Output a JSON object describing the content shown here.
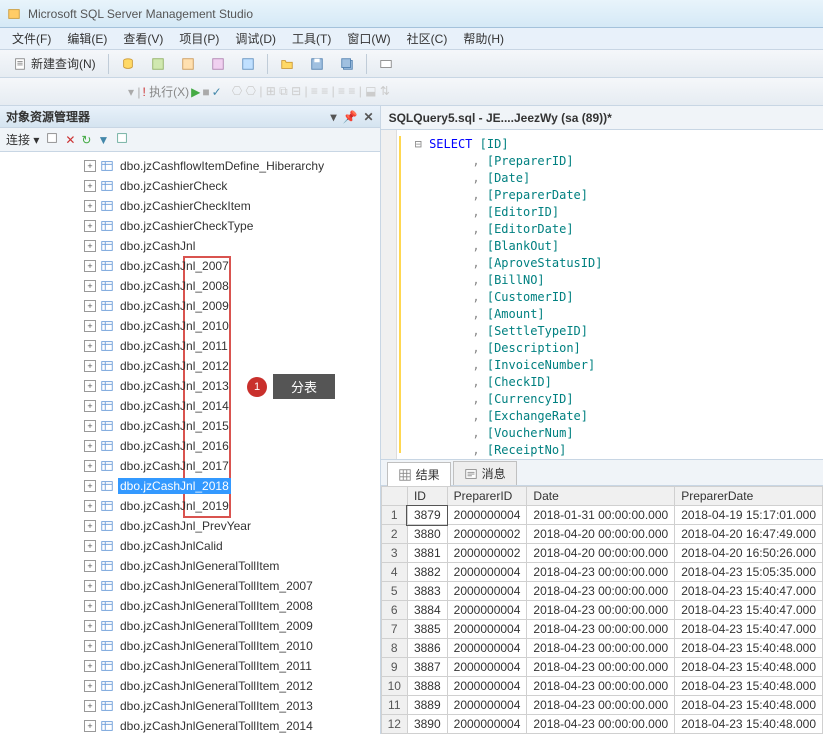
{
  "titlebar": {
    "title": "Microsoft SQL Server Management Studio"
  },
  "menubar": {
    "file": "文件(F)",
    "edit": "编辑(E)",
    "view": "查看(V)",
    "project": "项目(P)",
    "debug": "调试(D)",
    "tools": "工具(T)",
    "window": "窗口(W)",
    "community": "社区(C)",
    "help": "帮助(H)"
  },
  "toolbar": {
    "new_query": "新建查询(N)"
  },
  "toolbar2": {
    "execute": "执行(X)"
  },
  "left_pane": {
    "title": "对象资源管理器",
    "connect": "连接 ▾",
    "tree": [
      "dbo.jzCashflowItemDefine_Hiberarchy",
      "dbo.jzCashierCheck",
      "dbo.jzCashierCheckItem",
      "dbo.jzCashierCheckType",
      "dbo.jzCashJnl",
      "dbo.jzCashJnl_2007",
      "dbo.jzCashJnl_2008",
      "dbo.jzCashJnl_2009",
      "dbo.jzCashJnl_2010",
      "dbo.jzCashJnl_2011",
      "dbo.jzCashJnl_2012",
      "dbo.jzCashJnl_2013",
      "dbo.jzCashJnl_2014",
      "dbo.jzCashJnl_2015",
      "dbo.jzCashJnl_2016",
      "dbo.jzCashJnl_2017",
      "dbo.jzCashJnl_2018",
      "dbo.jzCashJnl_2019",
      "dbo.jzCashJnl_PrevYear",
      "dbo.jzCashJnlCalid",
      "dbo.jzCashJnlGeneralTollItem",
      "dbo.jzCashJnlGeneralTollItem_2007",
      "dbo.jzCashJnlGeneralTollItem_2008",
      "dbo.jzCashJnlGeneralTollItem_2009",
      "dbo.jzCashJnlGeneralTollItem_2010",
      "dbo.jzCashJnlGeneralTollItem_2011",
      "dbo.jzCashJnlGeneralTollItem_2012",
      "dbo.jzCashJnlGeneralTollItem_2013",
      "dbo.jzCashJnlGeneralTollItem_2014"
    ],
    "selected_index": 16,
    "annot": {
      "num": "1",
      "label": "分表"
    }
  },
  "right_pane": {
    "tab_title": "SQLQuery5.sql - JE....JeezWy (sa (89))*",
    "sql_select": "SELECT",
    "sql_first": "[ID]",
    "sql_cols": [
      "[PreparerID]",
      "[Date]",
      "[PreparerDate]",
      "[EditorID]",
      "[EditorDate]",
      "[BlankOut]",
      "[AproveStatusID]",
      "[BillNO]",
      "[CustomerID]",
      "[Amount]",
      "[SettleTypeID]",
      "[Description]",
      "[InvoiceNumber]",
      "[CheckID]",
      "[CurrencyID]",
      "[ExchangeRate]",
      "[VoucherNum]",
      "[ReceiptNo]"
    ],
    "result_tab": "结果",
    "message_tab": "消息",
    "cols": [
      "",
      "ID",
      "PreparerID",
      "Date",
      "PreparerDate"
    ],
    "rows": [
      [
        "1",
        "3879",
        "2000000004",
        "2018-01-31 00:00:00.000",
        "2018-04-19 15:17:01.000"
      ],
      [
        "2",
        "3880",
        "2000000002",
        "2018-04-20 00:00:00.000",
        "2018-04-20 16:47:49.000"
      ],
      [
        "3",
        "3881",
        "2000000002",
        "2018-04-20 00:00:00.000",
        "2018-04-20 16:50:26.000"
      ],
      [
        "4",
        "3882",
        "2000000004",
        "2018-04-23 00:00:00.000",
        "2018-04-23 15:05:35.000"
      ],
      [
        "5",
        "3883",
        "2000000004",
        "2018-04-23 00:00:00.000",
        "2018-04-23 15:40:47.000"
      ],
      [
        "6",
        "3884",
        "2000000004",
        "2018-04-23 00:00:00.000",
        "2018-04-23 15:40:47.000"
      ],
      [
        "7",
        "3885",
        "2000000004",
        "2018-04-23 00:00:00.000",
        "2018-04-23 15:40:47.000"
      ],
      [
        "8",
        "3886",
        "2000000004",
        "2018-04-23 00:00:00.000",
        "2018-04-23 15:40:48.000"
      ],
      [
        "9",
        "3887",
        "2000000004",
        "2018-04-23 00:00:00.000",
        "2018-04-23 15:40:48.000"
      ],
      [
        "10",
        "3888",
        "2000000004",
        "2018-04-23 00:00:00.000",
        "2018-04-23 15:40:48.000"
      ],
      [
        "11",
        "3889",
        "2000000004",
        "2018-04-23 00:00:00.000",
        "2018-04-23 15:40:48.000"
      ],
      [
        "12",
        "3890",
        "2000000004",
        "2018-04-23 00:00:00.000",
        "2018-04-23 15:40:48.000"
      ]
    ]
  }
}
